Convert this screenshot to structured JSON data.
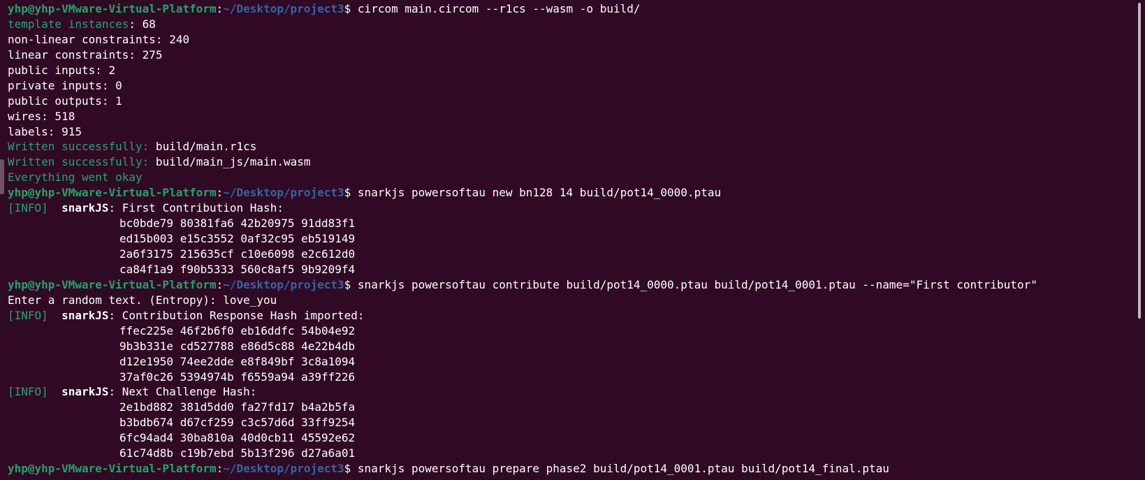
{
  "prompt": {
    "user_host": "yhp@yhp-VMware-Virtual-Platform",
    "sep": ":",
    "path": "~/Desktop/project3",
    "dollar": "$ "
  },
  "commands": [
    "circom main.circom --r1cs --wasm -o build/",
    "snarkjs powersoftau new bn128 14 build/pot14_0000.ptau",
    "snarkjs powersoftau contribute build/pot14_0000.ptau build/pot14_0001.ptau --name=\"First contributor\"",
    "snarkjs powersoftau prepare phase2 build/pot14_0001.ptau build/pot14_final.ptau"
  ],
  "circom_output": {
    "template_label": "template instances",
    "template_value": ": 68",
    "stats": [
      "non-linear constraints: 240",
      "linear constraints: 275",
      "public inputs: 2",
      "private inputs: 0",
      "public outputs: 1",
      "wires: 518",
      "labels: 915"
    ],
    "written_label": "Written successfully:",
    "written_files": [
      " build/main.r1cs",
      " build/main_js/main.wasm"
    ],
    "done": "Everything went okay"
  },
  "snark": {
    "info_tag": "[INFO]",
    "name": "snarkJS",
    "first_hash_title": ": First Contribution Hash:",
    "first_hash": [
      "bc0bde79 80381fa6 42b20975 91dd83f1",
      "ed15b003 e15c3552 0af32c95 eb519149",
      "2a6f3175 215635cf c10e6098 e2c612d0",
      "ca84f1a9 f90b5333 560c8af5 9b9209f4"
    ],
    "entropy_line": "Enter a random text. (Entropy): love_you",
    "response_hash_title": ": Contribution Response Hash imported:",
    "response_hash": [
      "ffec225e 46f2b6f0 eb16ddfc 54b04e92",
      "9b3b331e cd527788 e86d5c88 4e22b4db",
      "d12e1950 74ee2dde e8f849bf 3c8a1094",
      "37af0c26 5394974b f6559a94 a39ff226"
    ],
    "next_hash_title": ": Next Challenge Hash:",
    "next_hash": [
      "2e1bd882 381d5dd0 fa27fd17 b4a2b5fa",
      "b3bdb674 d67cf259 c3c57d6d 33ff9254",
      "6fc94ad4 30ba810a 40d0cb11 45592e62",
      "61c74d8b c19b7ebd 5b13f296 d27a6a01"
    ]
  },
  "colors": {
    "background": "#300a24",
    "prompt_user": "#26a269",
    "prompt_path": "#3465a4",
    "success_text": "#2aa172"
  }
}
